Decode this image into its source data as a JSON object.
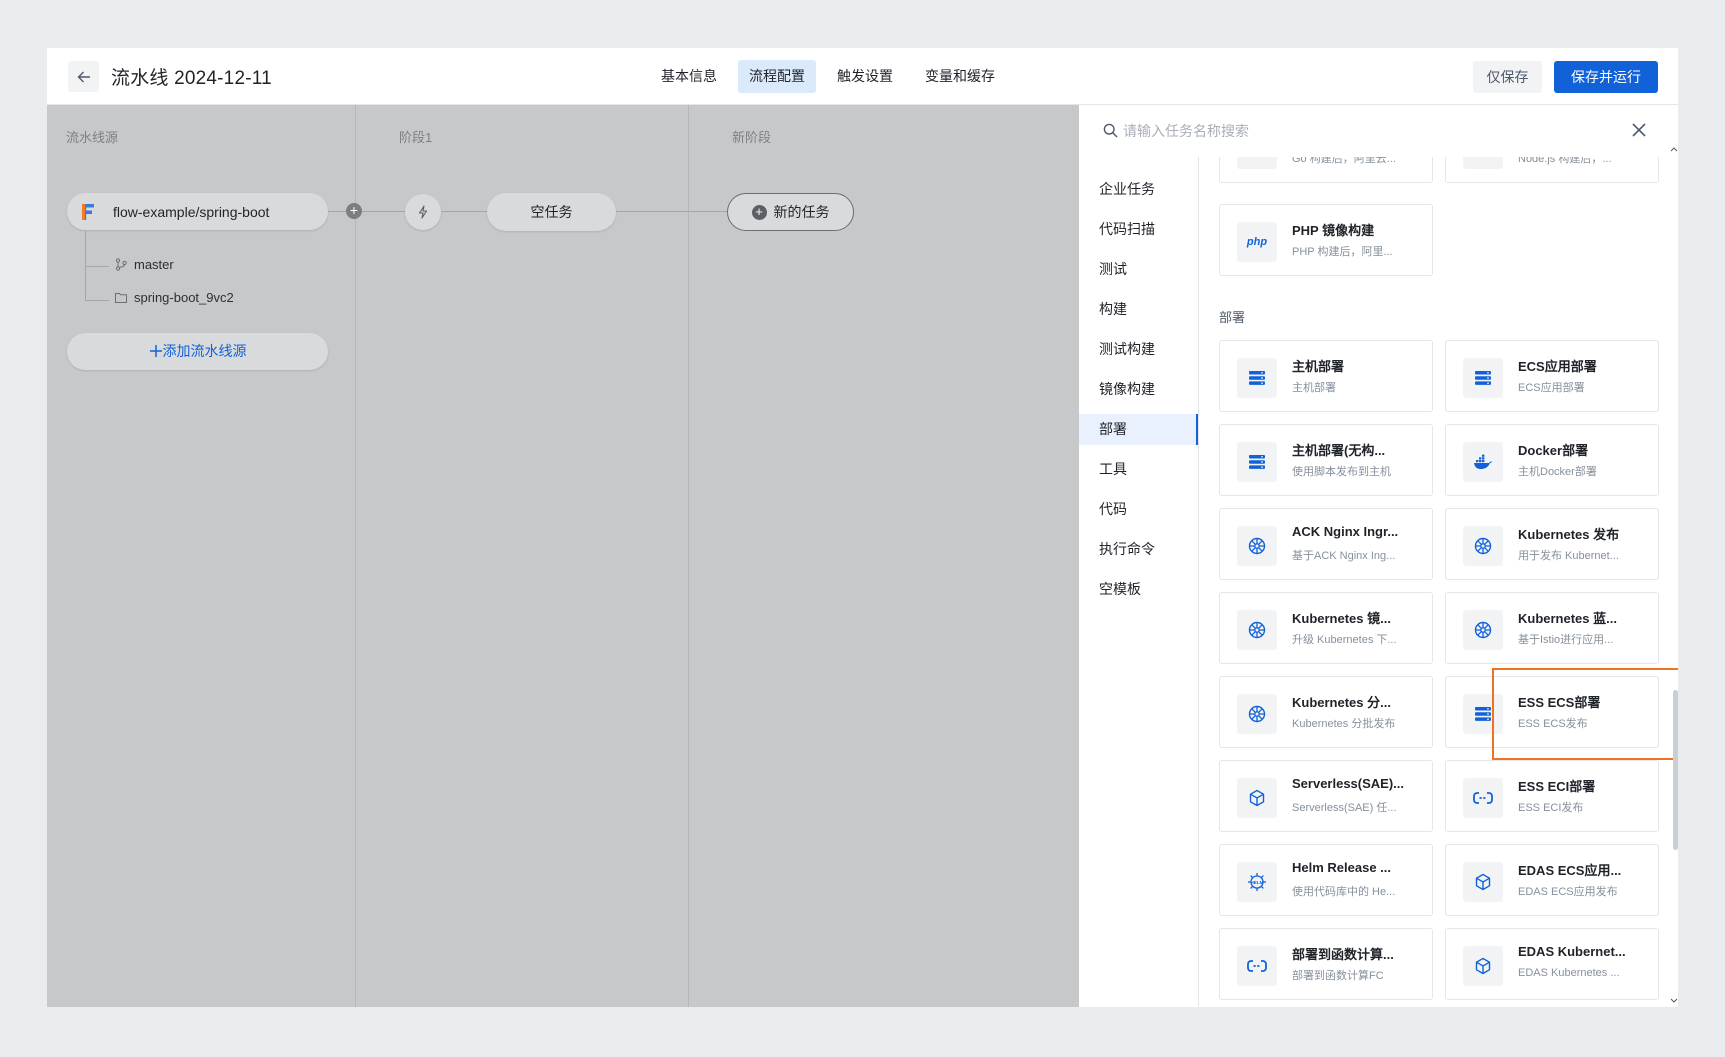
{
  "header": {
    "back_icon": "arrow-left-icon",
    "title": "流水线 2024-12-11",
    "tabs": [
      {
        "label": "基本信息",
        "active": false
      },
      {
        "label": "流程配置",
        "active": true
      },
      {
        "label": "触发设置",
        "active": false
      },
      {
        "label": "变量和缓存",
        "active": false
      }
    ],
    "save_only_label": "仅保存",
    "save_run_label": "保存并运行"
  },
  "canvas": {
    "stages": [
      {
        "title": "流水线源"
      },
      {
        "title": "阶段1"
      },
      {
        "title": "新阶段"
      }
    ],
    "source": {
      "name": "flow-example/spring-boot",
      "branch": "master",
      "folder": "spring-boot_9vc2"
    },
    "add_source_label": "添加流水线源",
    "empty_task_label": "空任务",
    "new_task_label": "新的任务"
  },
  "drawer": {
    "search_placeholder": "请输入任务名称搜索",
    "categories": [
      {
        "label": "企业任务",
        "active": false
      },
      {
        "label": "代码扫描",
        "active": false
      },
      {
        "label": "测试",
        "active": false
      },
      {
        "label": "构建",
        "active": false
      },
      {
        "label": "测试构建",
        "active": false
      },
      {
        "label": "镜像构建",
        "active": false
      },
      {
        "label": "部署",
        "active": true
      },
      {
        "label": "工具",
        "active": false
      },
      {
        "label": "代码",
        "active": false
      },
      {
        "label": "执行命令",
        "active": false
      },
      {
        "label": "空模板",
        "active": false
      }
    ],
    "partial_cards": [
      {
        "desc": "Go 构建后，阿里云..."
      },
      {
        "desc": "Node.js 构建后，..."
      }
    ],
    "php_card": {
      "name": "PHP 镜像构建",
      "desc": "PHP 构建后，阿里...",
      "icon": "php-icon"
    },
    "deploy_section_title": "部署",
    "deploy_cards": [
      {
        "name": "主机部署",
        "desc": "主机部署",
        "icon": "server-icon"
      },
      {
        "name": "ECS应用部署",
        "desc": "ECS应用部署",
        "icon": "server-icon"
      },
      {
        "name": "主机部署(无构...",
        "desc": "使用脚本发布到主机",
        "icon": "server-icon"
      },
      {
        "name": "Docker部署",
        "desc": "主机Docker部署",
        "icon": "docker-icon"
      },
      {
        "name": "ACK Nginx Ingr...",
        "desc": "基于ACK Nginx Ing...",
        "icon": "kubernetes-icon"
      },
      {
        "name": "Kubernetes 发布",
        "desc": "用于发布 Kubernet...",
        "icon": "kubernetes-icon"
      },
      {
        "name": "Kubernetes 镜...",
        "desc": "升级 Kubernetes 下...",
        "icon": "kubernetes-icon"
      },
      {
        "name": "Kubernetes 蓝...",
        "desc": "基于Istio进行应用...",
        "icon": "kubernetes-icon"
      },
      {
        "name": "Kubernetes 分...",
        "desc": "Kubernetes 分批发布",
        "icon": "kubernetes-icon"
      },
      {
        "name": "ESS ECS部署",
        "desc": "ESS ECS发布",
        "icon": "server-icon",
        "highlighted": true
      },
      {
        "name": "Serverless(SAE)...",
        "desc": "Serverless(SAE) 任...",
        "icon": "cube-icon"
      },
      {
        "name": "ESS ECI部署",
        "desc": "ESS ECI发布",
        "icon": "link-icon"
      },
      {
        "name": "Helm Release ...",
        "desc": "使用代码库中的 He...",
        "icon": "helm-icon"
      },
      {
        "name": "EDAS ECS应用...",
        "desc": "EDAS ECS应用发布",
        "icon": "cube-icon"
      },
      {
        "name": "部署到函数计算...",
        "desc": "部署到函数计算FC",
        "icon": "link-icon"
      },
      {
        "name": "EDAS Kubernet...",
        "desc": "EDAS Kubernetes ...",
        "icon": "cube-icon"
      }
    ],
    "accent_color": "#1162d9",
    "highlight_color": "#f07324"
  }
}
